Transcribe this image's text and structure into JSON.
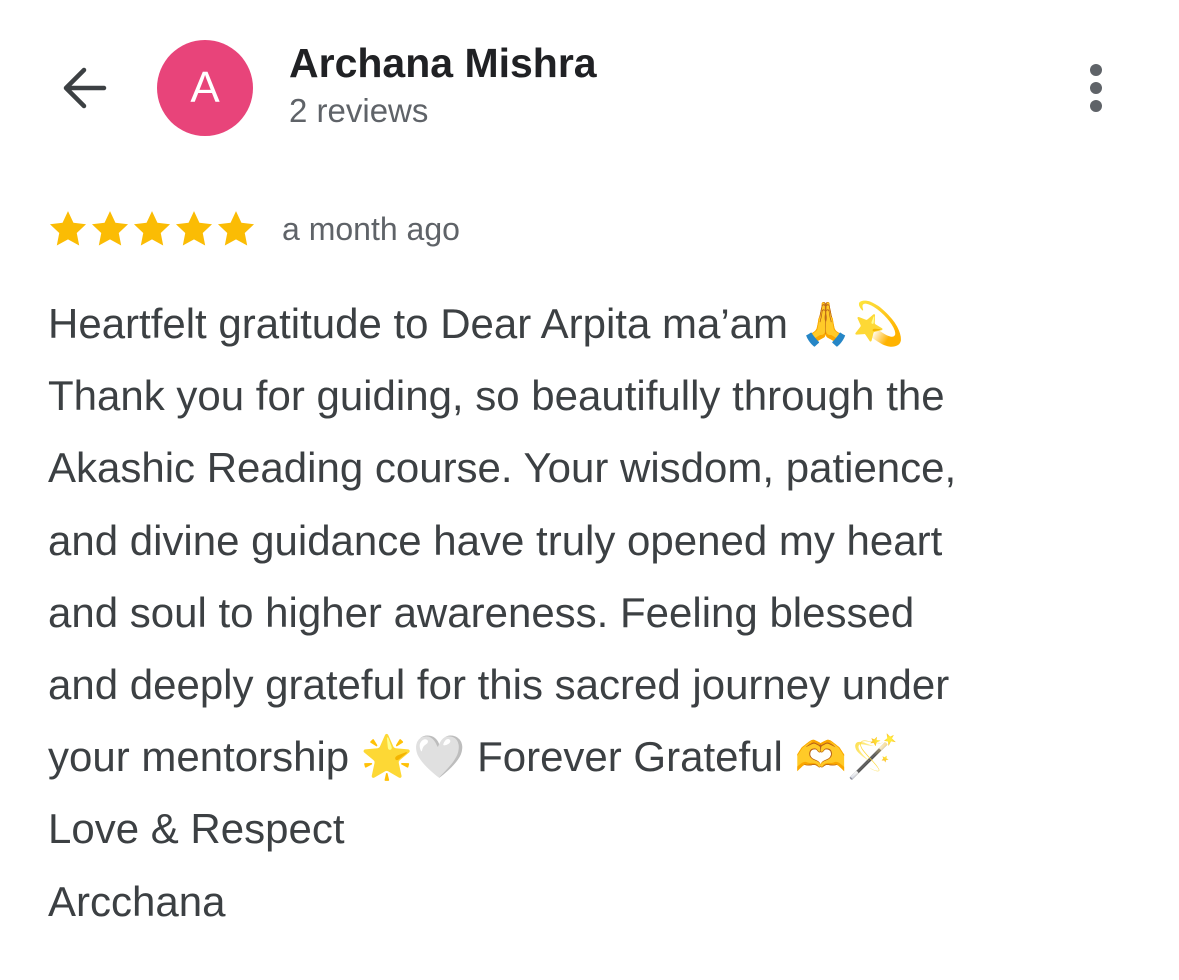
{
  "header": {
    "back_icon": "arrow-back-icon",
    "avatar_letter": "A",
    "avatar_color": "#e8447a",
    "reviewer_name": "Archana Mishra",
    "review_count": "2 reviews",
    "more_icon": "more-vert-icon"
  },
  "review": {
    "rating": 5,
    "max_rating": 5,
    "star_color": "#fbbc04",
    "time_ago": "a month ago",
    "lines": [
      "Heartfelt gratitude to Dear Arpita ma’am 🙏💫",
      "Thank you for guiding, so beautifully through the",
      "Akashic Reading course. Your wisdom, patience,",
      "and divine guidance have truly opened my heart",
      "and soul to higher awareness. Feeling blessed",
      "and deeply grateful for this sacred journey under",
      "your mentorship 🌟🤍 Forever Grateful 🫶🪄",
      "Love & Respect",
      "Arcchana"
    ]
  }
}
